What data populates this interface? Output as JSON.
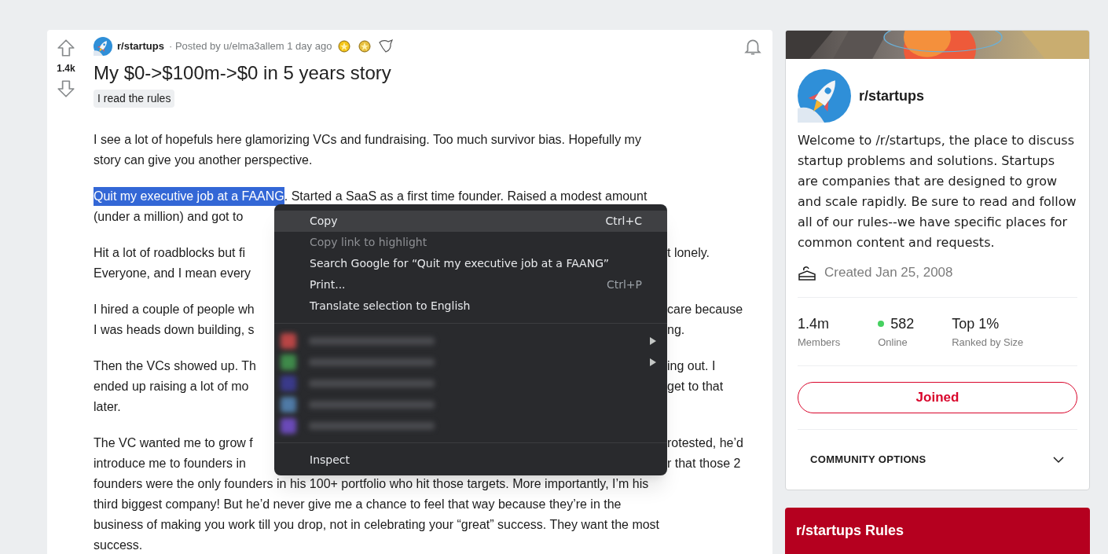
{
  "post": {
    "votes": "1.4k",
    "subreddit": "r/startups",
    "meta": "· Posted by u/elma3allem 1 day ago",
    "title": "My $0->$100m->$0 in 5 years story",
    "flair": "I read the rules",
    "paragraphs": [
      {
        "lines": [
          {
            "left": "I see a lot of hopefuls here glamorizing VCs and fundraising. Too much survivor bias. Hopefully my"
          },
          {
            "left": "story can give you another perspective."
          }
        ]
      },
      {
        "lines": [
          {
            "selected": "Quit my executive job at a FAANG",
            "left": ". Started a SaaS as a first time founder. Raised a modest amount"
          },
          {
            "left": "(under a million) and got to"
          }
        ]
      },
      {
        "lines": [
          {
            "left": "Hit a lot of roadblocks but fi",
            "right": "t lonely."
          },
          {
            "left": "Everyone, and I mean every"
          }
        ]
      },
      {
        "lines": [
          {
            "left": "I hired a couple of people wh",
            "right": "care because"
          },
          {
            "left": "I was heads down building, s",
            "right": "ng."
          }
        ]
      },
      {
        "lines": [
          {
            "left": "Then the VCs showed up. Th",
            "right": "ing out. I"
          },
          {
            "left": "ended up raising a lot of mo",
            "right": "get to that"
          },
          {
            "left": "later."
          }
        ]
      },
      {
        "lines": [
          {
            "left": "The VC wanted me to grow f",
            "right": "rotested, he’d"
          },
          {
            "left": "introduce me to founders in",
            "right": "r that those 2"
          },
          {
            "left": "founders were the only founders in his 100+ portfolio who hit those targets. More importantly, I’m his"
          },
          {
            "left": "third biggest company! But he’d never give me a chance to feel that way because they’re in the"
          },
          {
            "left": "business of making you work till you drop, not in celebrating your “great” success. They want the most"
          },
          {
            "left": "success."
          }
        ]
      }
    ]
  },
  "context_menu": [
    {
      "kind": "item",
      "label": "Copy",
      "shortcut": "Ctrl+C",
      "selected": true,
      "disabled": false
    },
    {
      "kind": "item",
      "label": "Copy link to highlight",
      "selected": false,
      "disabled": true
    },
    {
      "kind": "item",
      "label": "Search Google for “Quit my executive job at a FAANG”",
      "selected": false,
      "disabled": false
    },
    {
      "kind": "item",
      "label": "Print...",
      "shortcut": "Ctrl+P",
      "selected": false,
      "disabled": false
    },
    {
      "kind": "item",
      "label": "Translate selection to English",
      "selected": false,
      "disabled": false
    },
    {
      "kind": "separator"
    },
    {
      "kind": "blurred",
      "color": "#b84545",
      "submenu": true
    },
    {
      "kind": "blurred",
      "color": "#3f8a4a",
      "submenu": true
    },
    {
      "kind": "blurred",
      "color": "#3a3a8a",
      "submenu": false
    },
    {
      "kind": "blurred",
      "color": "#4f7aa6",
      "submenu": false
    },
    {
      "kind": "blurred",
      "color": "#6a4ab8",
      "submenu": false
    },
    {
      "kind": "separator"
    },
    {
      "kind": "item",
      "label": "Inspect",
      "selected": false,
      "disabled": false
    }
  ],
  "sidebar": {
    "name": "r/startups",
    "description": "Welcome to /r/startups, the place to discuss startup problems and solutions. Startups are companies that are designed to grow and scale rapidly. Be sure to read and follow all of our rules--we have specific places for common content and requests.",
    "created": "Created Jan 25, 2008",
    "stats": [
      {
        "value": "1.4m",
        "label": "Members",
        "online": false
      },
      {
        "value": "582",
        "label": "Online",
        "online": true
      },
      {
        "value": "Top 1%",
        "label": "Ranked by Size",
        "online": false
      }
    ],
    "join_button": "Joined",
    "options": "COMMUNITY OPTIONS",
    "rules_title": "r/startups Rules"
  }
}
